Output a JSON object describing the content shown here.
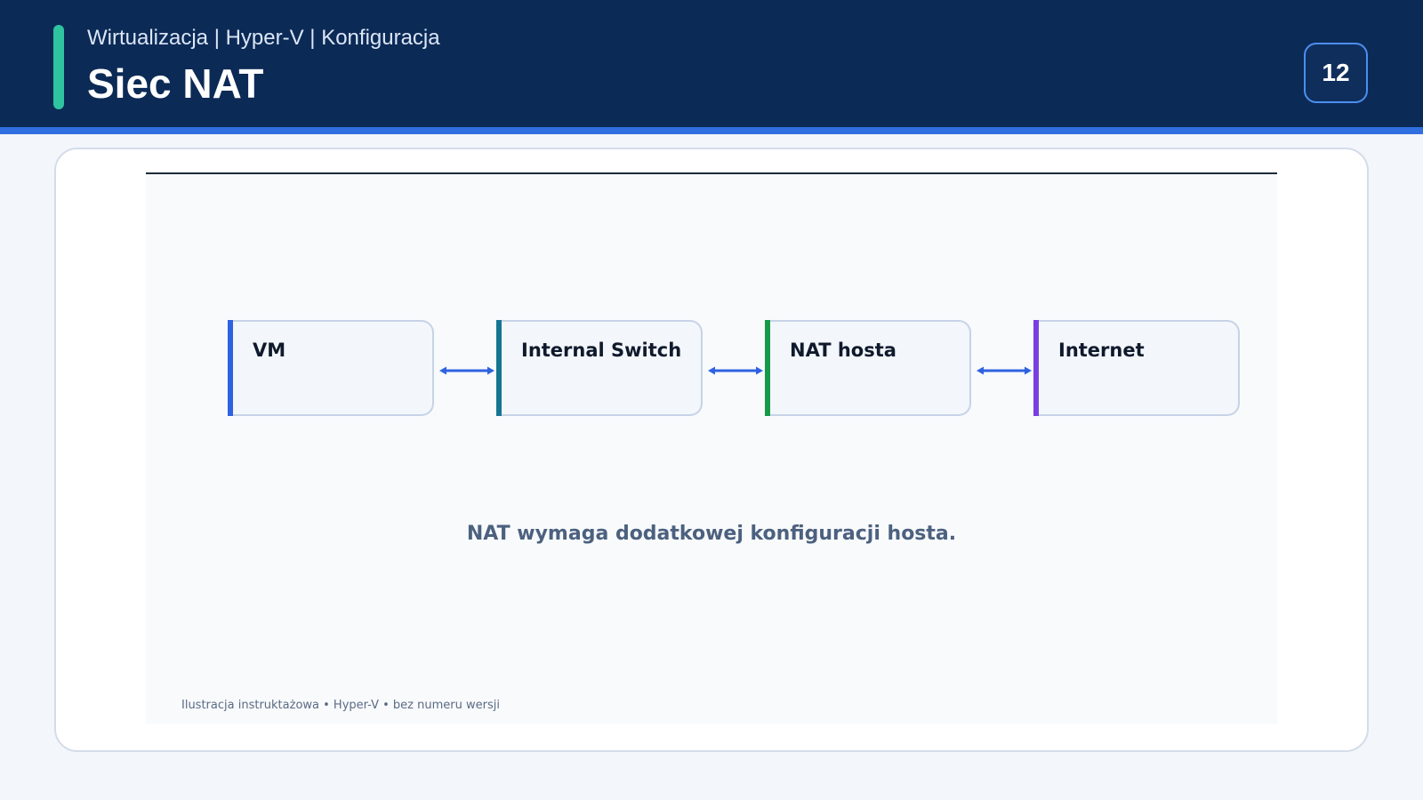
{
  "header": {
    "breadcrumb": "Wirtualizacja | Hyper-V | Konfiguracja",
    "title": "Siec NAT",
    "page_number": "12"
  },
  "diagram": {
    "nodes": [
      {
        "label": "VM",
        "accent": "#2f62e0"
      },
      {
        "label": "Internal Switch",
        "accent": "#167591"
      },
      {
        "label": "NAT hosta",
        "accent": "#17994a"
      },
      {
        "label": "Internet",
        "accent": "#7a3fe0"
      }
    ],
    "connector_color": "#2f62e0",
    "note": "NAT wymaga dodatkowej konfiguracji hosta.",
    "footnote": "Ilustracja instruktażowa • Hyper-V • bez numeru wersji"
  },
  "colors": {
    "header_bg": "#0c2a56",
    "stripe": "#2f6fe0",
    "accent": "#2ec4a0"
  }
}
